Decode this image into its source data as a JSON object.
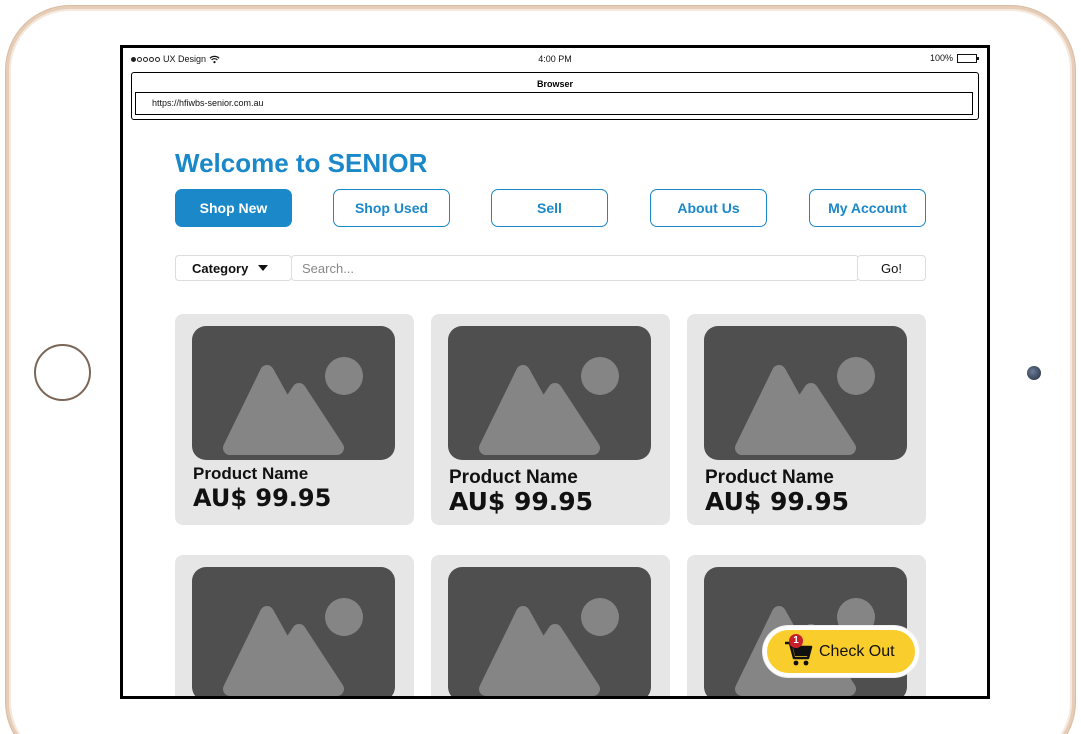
{
  "status_bar": {
    "carrier": "UX Design",
    "time": "4:00 PM",
    "battery": "100%"
  },
  "browser": {
    "title": "Browser",
    "url": "https://hfiwbs-senior.com.au"
  },
  "page": {
    "title": "Welcome to SENIOR"
  },
  "nav": {
    "shop_new": "Shop New",
    "shop_used": "Shop Used",
    "sell": "Sell",
    "about_us": "About Us",
    "my_account": "My Account"
  },
  "search": {
    "category_label": "Category",
    "placeholder": "Search...",
    "go_label": "Go!"
  },
  "products": [
    {
      "name": "Product Name",
      "price": "AU$ 99.95"
    },
    {
      "name": "Product Name",
      "price": "AU$ 99.95"
    },
    {
      "name": "Product Name",
      "price": "AU$ 99.95"
    }
  ],
  "checkout": {
    "label": "Check Out",
    "cart_count": "1"
  },
  "colors": {
    "accent": "#1a88c9",
    "checkout": "#f9cd2b",
    "badge": "#c8202b",
    "card_bg": "#e6e6e6",
    "image_placeholder": "#4f4f4f"
  }
}
